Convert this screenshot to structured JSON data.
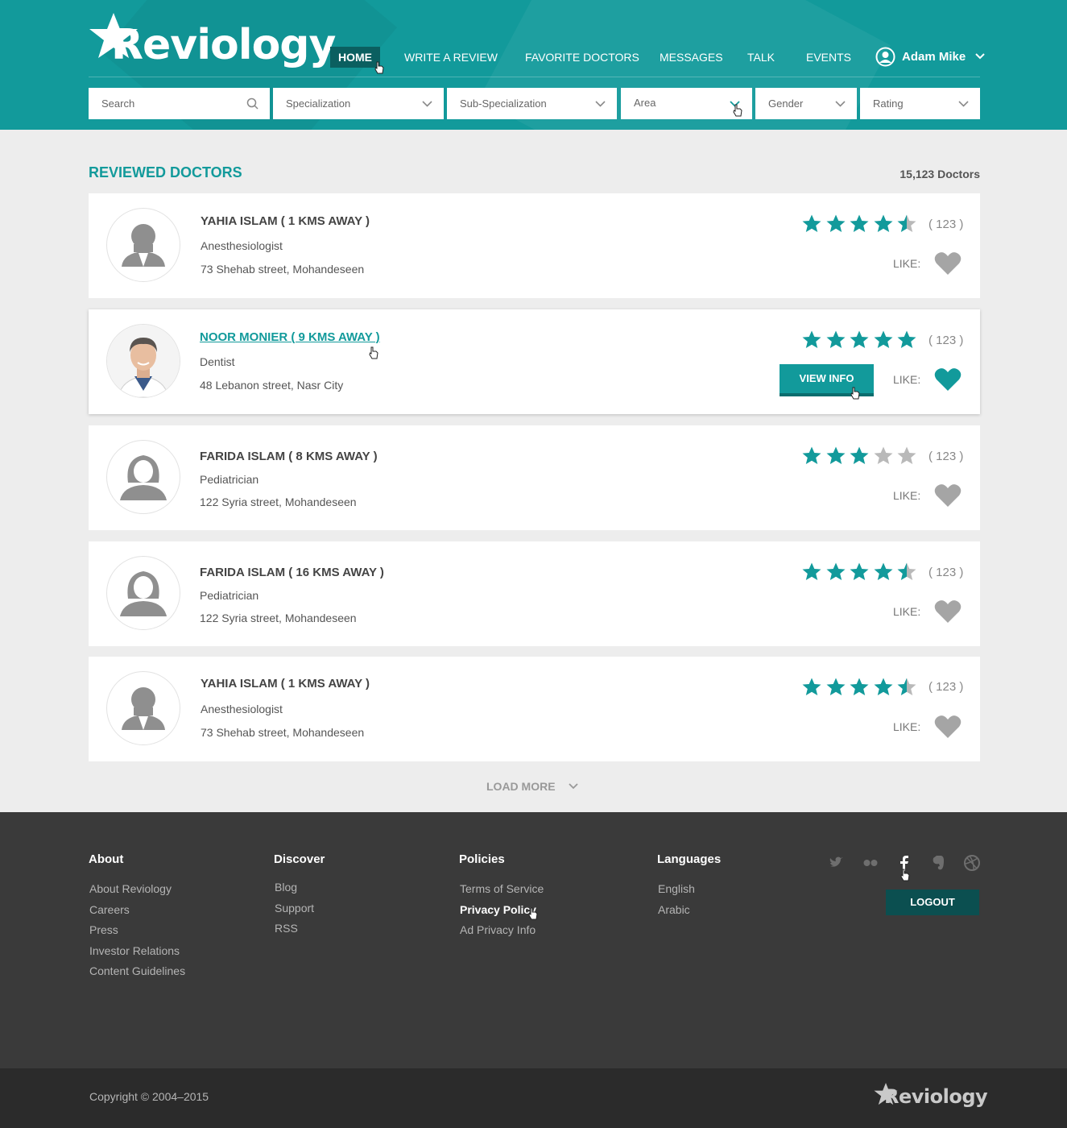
{
  "brand": {
    "name": "Reviology",
    "accent": "#129a9b",
    "dark_accent": "#0b5f60"
  },
  "nav": {
    "items": [
      {
        "label": "HOME",
        "active": true
      },
      {
        "label": "WRITE A REVIEW"
      },
      {
        "label": "FAVORITE DOCTORS"
      },
      {
        "label": "MESSAGES"
      },
      {
        "label": "TALK"
      },
      {
        "label": "EVENTS"
      }
    ],
    "user": {
      "name": "Adam Mike",
      "icon": "user-circle-icon"
    }
  },
  "filters": {
    "search_placeholder": "Search",
    "specialization": "Specialization",
    "sub_specialization": "Sub-Specialization",
    "area": "Area",
    "gender": "Gender",
    "rating": "Rating"
  },
  "main": {
    "title": "REVIEWED DOCTORS",
    "count": "15,123 Doctors",
    "like_label": "LIKE:",
    "view_info_label": "VIEW INFO",
    "load_more": "LOAD MORE",
    "doctors": [
      {
        "name": "YAHIA ISLAM ( 1 KMS  AWAY )",
        "specialty": "Anesthesiologist",
        "address": "73 Shehab street, Mohandeseen",
        "rating": 4.5,
        "reviews": "( 123 )",
        "liked": false,
        "avatar": "male-placeholder"
      },
      {
        "name": "NOOR MONIER ( 9 KMS AWAY )",
        "specialty": "Dentist",
        "address": "48 Lebanon street, Nasr City",
        "rating": 5,
        "reviews": "( 123 )",
        "liked": true,
        "avatar": "photo"
      },
      {
        "name": "FARIDA ISLAM ( 8 KMS AWAY )",
        "specialty": "Pediatrician",
        "address": "122 Syria street, Mohandeseen",
        "rating": 3,
        "reviews": "( 123 )",
        "liked": false,
        "avatar": "female-placeholder"
      },
      {
        "name": "FARIDA ISLAM ( 16 KMS AWAY )",
        "specialty": "Pediatrician",
        "address": "122 Syria street, Mohandeseen",
        "rating": 4.5,
        "reviews": "( 123 )",
        "liked": false,
        "avatar": "female-placeholder"
      },
      {
        "name": "YAHIA ISLAM ( 1 KMS  AWAY )",
        "specialty": "Anesthesiologist",
        "address": "73 Shehab street, Mohandeseen",
        "rating": 4.5,
        "reviews": "( 123 )",
        "liked": false,
        "avatar": "male-placeholder"
      }
    ]
  },
  "footer": {
    "columns": [
      {
        "title": "About",
        "links": [
          "About Reviology",
          "Careers",
          "Press",
          "Investor Relations",
          "Content Guidelines"
        ]
      },
      {
        "title": "Discover",
        "links": [
          "Blog",
          "Support",
          "RSS"
        ]
      },
      {
        "title": "Policies",
        "links": [
          "Terms of Service",
          "Privacy Policy",
          "Ad Privacy Info"
        ]
      },
      {
        "title": "Languages",
        "links": [
          "English",
          "Arabic"
        ]
      }
    ],
    "socials": [
      "twitter-icon",
      "flickr-icon",
      "facebook-icon",
      "evernote-icon",
      "dribbble-icon"
    ],
    "logout": "LOGOUT",
    "copyright": "Copyright © 2004–2015"
  }
}
